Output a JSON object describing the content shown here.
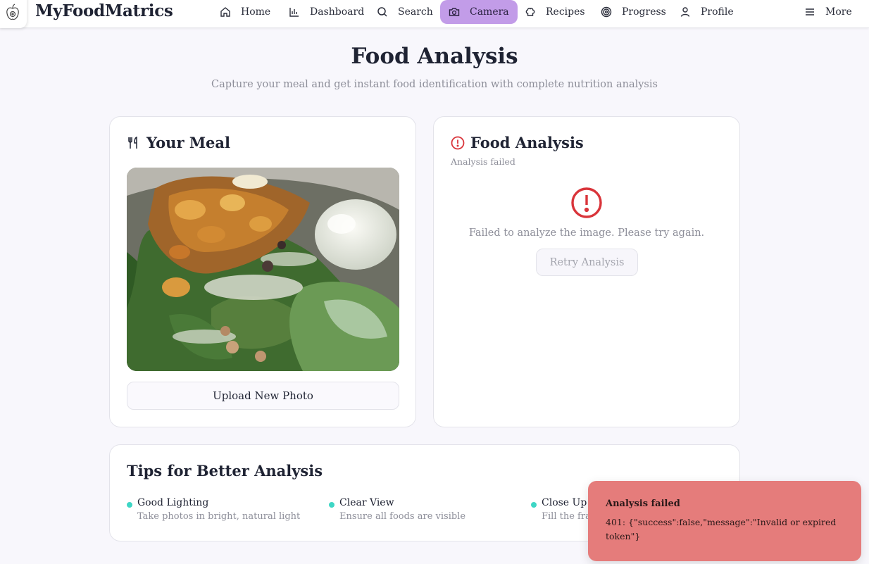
{
  "app": {
    "brand": "MyFoodMatrics"
  },
  "nav": {
    "items": [
      {
        "label": "Home",
        "icon": "home-icon"
      },
      {
        "label": "Dashboard",
        "icon": "bar-chart-icon"
      },
      {
        "label": "Search",
        "icon": "search-icon"
      },
      {
        "label": "Camera",
        "icon": "camera-icon",
        "active": true
      },
      {
        "label": "Recipes",
        "icon": "chef-hat-icon"
      },
      {
        "label": "Progress",
        "icon": "target-icon"
      },
      {
        "label": "Profile",
        "icon": "user-icon"
      }
    ],
    "more": {
      "label": "More",
      "icon": "menu-icon"
    }
  },
  "header": {
    "title": "Food Analysis",
    "subtitle": "Capture your meal and get instant food identification with complete nutrition analysis"
  },
  "meal_card": {
    "title": "Your Meal",
    "title_icon": "utensils-icon",
    "photo_icon": "food-photo",
    "upload_label": "Upload New Photo"
  },
  "analysis_card": {
    "title": "Food Analysis",
    "title_icon": "alert-circle-icon",
    "status": "Analysis failed",
    "error_message": "Failed to analyze the image. Please try again.",
    "retry_label": "Retry Analysis"
  },
  "tips": {
    "title": "Tips for Better Analysis",
    "items": [
      {
        "title": "Good Lighting",
        "desc": "Take photos in bright, natural light"
      },
      {
        "title": "Clear View",
        "desc": "Ensure all foods are visible"
      },
      {
        "title": "Close Up",
        "desc": "Fill the fram"
      }
    ]
  },
  "toast": {
    "title": "Analysis failed",
    "message": "401: {\"success\":false,\"message\":\"Invalid or expired token\"}"
  },
  "colors": {
    "accent_active": "#c29ce8",
    "error": "#d9343a",
    "toast_bg": "#e57c7b",
    "tip_dot": "#3ed6c5",
    "page_bg": "#f8f7fc"
  }
}
